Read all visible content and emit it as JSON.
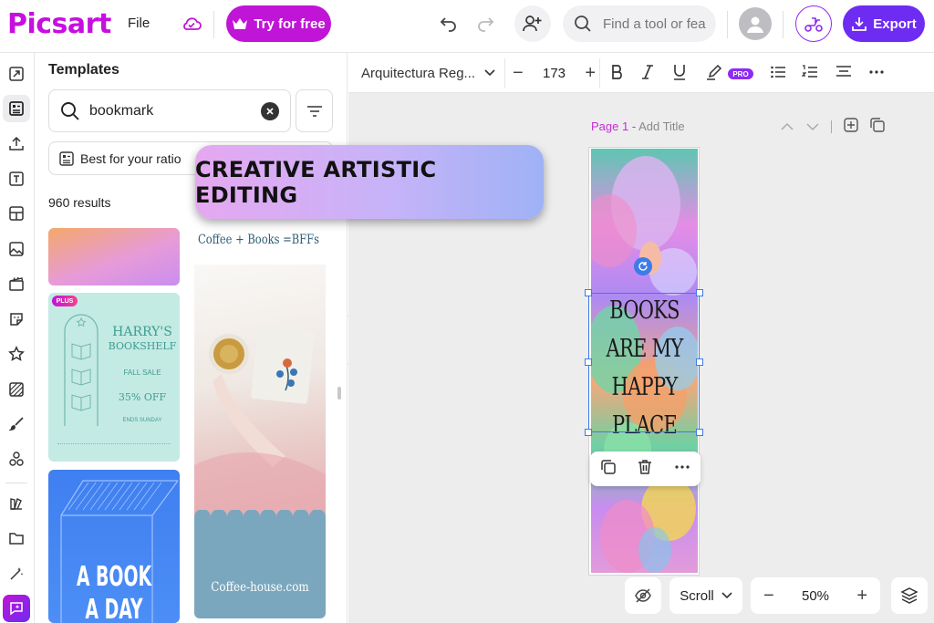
{
  "topbar": {
    "logo": "Picsart",
    "file_menu": "File",
    "try_button": "Try for free",
    "search_placeholder": "Find a tool or fea",
    "export_button": "Export"
  },
  "panel": {
    "title": "Templates",
    "search_value": "bookmark",
    "ratio_chip": "Best for your ratio",
    "results_count": "960 results",
    "templates": [
      {
        "badge": "PLUS",
        "title_line1": "HARRY'S",
        "title_line2": "BOOKSHELF",
        "line_fall": "FALL SALE",
        "line_off": "35% OFF",
        "line_ends": "ENDS SUNDAY"
      },
      {
        "title": "Coffee + Books =BFFs",
        "footer": "Coffee-house.com"
      },
      {
        "title_line1": "A BOOK",
        "title_line2": "A DAY"
      }
    ]
  },
  "texttool": {
    "font": "Arquitectura Reg...",
    "size": "173",
    "pro_badge": "PRO"
  },
  "canvas": {
    "page_label": "Page 1 -",
    "add_title": "Add Title",
    "bookmark_text": [
      "BOOKS",
      "ARE MY",
      "HAPPY",
      "PLACE"
    ]
  },
  "bottom": {
    "scroll_mode": "Scroll",
    "zoom": "50%"
  },
  "banner": "CREATIVE ARTISTIC EDITING",
  "colors": {
    "brand": "#c70ee0",
    "try_button": "#c014d7",
    "export_button": "#6e2bf2",
    "selection": "#3d7be8"
  }
}
